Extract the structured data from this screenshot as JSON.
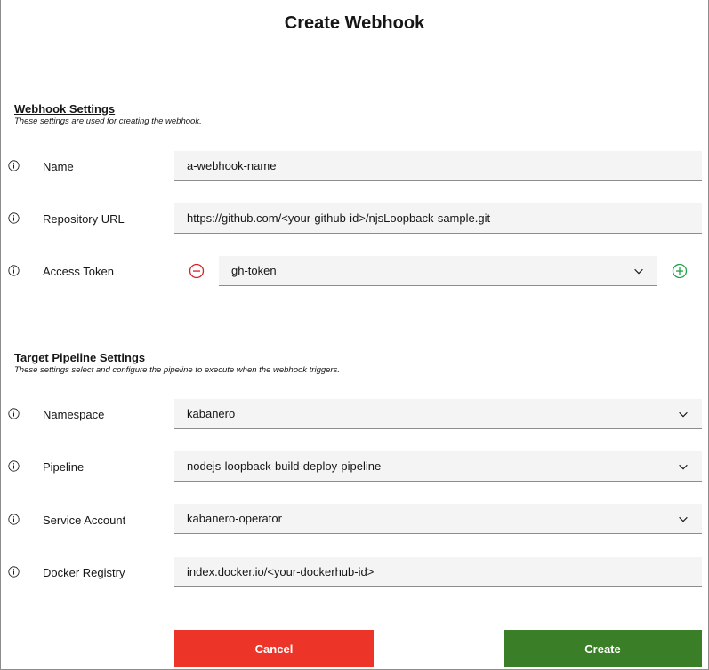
{
  "dialog": {
    "title": "Create Webhook"
  },
  "webhook_settings": {
    "heading": "Webhook Settings",
    "subheading": "These settings are used for creating the webhook.",
    "name": {
      "label": "Name",
      "value": "a-webhook-name"
    },
    "repository_url": {
      "label": "Repository URL",
      "value": "https://github.com/<your-github-id>/njsLoopback-sample.git"
    },
    "access_token": {
      "label": "Access Token",
      "value": "gh-token"
    }
  },
  "pipeline_settings": {
    "heading": "Target Pipeline Settings",
    "subheading": "These settings select and configure the pipeline to execute when the webhook triggers.",
    "namespace": {
      "label": "Namespace",
      "value": "kabanero"
    },
    "pipeline": {
      "label": "Pipeline",
      "value": "nodejs-loopback-build-deploy-pipeline"
    },
    "service_account": {
      "label": "Service Account",
      "value": "kabanero-operator"
    },
    "docker_registry": {
      "label": "Docker Registry",
      "value": "index.docker.io/<your-dockerhub-id>"
    }
  },
  "actions": {
    "cancel": "Cancel",
    "create": "Create"
  },
  "colors": {
    "cancel": "#ec3528",
    "create": "#3a7e27",
    "remove_icon": "#da1e28",
    "add_icon": "#24a148",
    "field_bg": "#f4f4f4"
  },
  "icons": {
    "info": "info-icon",
    "dropdown": "chevron-down-icon",
    "remove": "subtract-circle-icon",
    "add": "add-circle-icon"
  }
}
